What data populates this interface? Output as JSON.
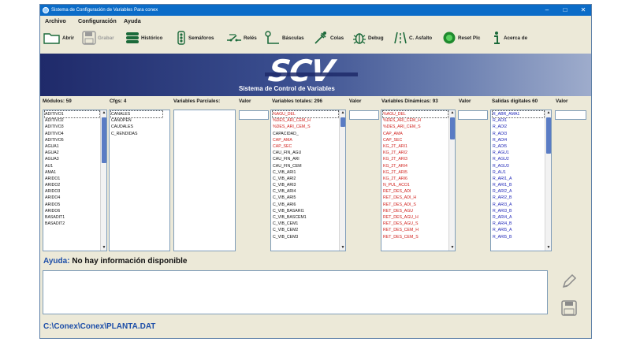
{
  "window": {
    "title": "Sistema de Configuración de Variables Para conex",
    "controls": {
      "minimize": "–",
      "maximize": "□",
      "close": "✕"
    }
  },
  "menu": [
    "Archivo",
    "Configuración",
    "Ayuda"
  ],
  "toolbar": [
    {
      "label": "Abrir",
      "icon": "folder-icon",
      "enabled": true
    },
    {
      "label": "Grabar",
      "icon": "save-icon",
      "enabled": false
    },
    {
      "label": "Histórico",
      "icon": "database-icon",
      "enabled": true
    },
    {
      "label": "Semáforos",
      "icon": "traffic-light-icon",
      "enabled": true
    },
    {
      "label": "Relés",
      "icon": "relay-switch-icon",
      "enabled": true
    },
    {
      "label": "Básculas",
      "icon": "scale-icon",
      "enabled": true
    },
    {
      "label": "Colas",
      "icon": "pipette-icon",
      "enabled": true
    },
    {
      "label": "Debug",
      "icon": "bug-icon",
      "enabled": true
    },
    {
      "label": "C. Asfalto",
      "icon": "road-icon",
      "enabled": true
    },
    {
      "label": "Reset Plc",
      "icon": "reset-green-icon",
      "enabled": true
    },
    {
      "label": "Acerca de",
      "icon": "info-icon",
      "enabled": true
    }
  ],
  "banner": {
    "logo": "SCV",
    "subtitle": "Sistema de Control de Variables"
  },
  "columns": {
    "modulos": {
      "header": "Módulos: 59",
      "items": [
        "ADITIVO1",
        "ADITIVO2",
        "ADITIVO3",
        "ADITIVO4",
        "ADITIVO5",
        "AGUA1",
        "AGUA2",
        "AGUA3",
        "AU1",
        "AMA1",
        "ARIDO1",
        "ARIDO2",
        "ARIDO3",
        "ARIDO4",
        "ARIDO5",
        "ARIDO6",
        "BASADIT1",
        "BASADIT2"
      ]
    },
    "cfgs": {
      "header": "Cfgs: 4",
      "items": [
        "CANALES",
        "CANOPEN",
        "CAUDALES",
        "C_RENDIDAS"
      ]
    },
    "parciales": {
      "header": "Variables Parciales:",
      "items": []
    },
    "valor1": {
      "header": "Valor"
    },
    "totales": {
      "header": "Variables totales: 296",
      "items": [
        {
          "t": "%AGU_DEL",
          "c": "red"
        },
        {
          "t": "%DES_ARI_CEM_H",
          "c": "red"
        },
        {
          "t": "%DES_ARI_CEM_S",
          "c": "red"
        },
        {
          "t": "CAPACIDAD_",
          "c": ""
        },
        {
          "t": "CAP_AMA",
          "c": "red"
        },
        {
          "t": "CAP_SEC",
          "c": "red"
        },
        {
          "t": "CAU_FIN_AGU",
          "c": ""
        },
        {
          "t": "CAU_FIN_ARI",
          "c": ""
        },
        {
          "t": "CAU_FIN_CEM",
          "c": ""
        },
        {
          "t": "C_VIB_ARI1",
          "c": ""
        },
        {
          "t": "C_VIB_ARI2",
          "c": ""
        },
        {
          "t": "C_VIB_ARI3",
          "c": ""
        },
        {
          "t": "C_VIB_ARI4",
          "c": ""
        },
        {
          "t": "C_VIB_ARI5",
          "c": ""
        },
        {
          "t": "C_VIB_ARI6",
          "c": ""
        },
        {
          "t": "C_VIB_BASARI1",
          "c": ""
        },
        {
          "t": "C_VIB_BASCEM1",
          "c": ""
        },
        {
          "t": "C_VIB_CEM1",
          "c": ""
        },
        {
          "t": "C_VIB_CEM2",
          "c": ""
        },
        {
          "t": "C_VIB_CEM3",
          "c": ""
        }
      ]
    },
    "valor2": {
      "header": "Valor"
    },
    "dinamicas": {
      "header": "Variables Dinámicas: 93",
      "items": [
        "%AGU_DEL",
        "%DES_ARI_CEM_H",
        "%DES_ARI_CEM_S",
        "CAP_AMA",
        "CAP_SEC",
        "KG_2T_ARI1",
        "KG_2T_ARI2",
        "KG_2T_ARI3",
        "KG_2T_ARI4",
        "KG_2T_ARI5",
        "KG_2T_ARI6",
        "N_PUL_ACO1",
        "RET_DES_ADI",
        "RET_DES_ADI_H",
        "RET_DES_ADI_S",
        "RET_DES_AGU",
        "RET_DES_AGU_H",
        "RET_DES_AGU_S",
        "RET_DES_CEM_H",
        "RET_DES_CEM_S"
      ]
    },
    "valor3": {
      "header": "Valor"
    },
    "salidas": {
      "header": "Salidas digitales 60",
      "items": [
        "R_ABR_AMA1",
        "R_ADI1",
        "R_ADI2",
        "R_ADI3",
        "R_ADI4",
        "R_ADI5",
        "R_AGU1",
        "R_AGU2",
        "R_AGU3",
        "R_AU1",
        "R_ARI1_A",
        "R_ARI1_B",
        "R_ARI2_A",
        "R_ARI2_B",
        "R_ARI3_A",
        "R_ARI3_B",
        "R_ARI4_A",
        "R_ARI4_B",
        "R_ARI5_A",
        "R_ARI5_B"
      ]
    },
    "valor4": {
      "header": "Valor"
    }
  },
  "help": {
    "label": "Ayuda:",
    "text": "No hay información disponible"
  },
  "side_buttons": {
    "edit": "pencil-icon",
    "save": "save-icon"
  },
  "file_path": "C:\\Conex\\Conex\\PLANTA.DAT",
  "colors": {
    "title_bar": "#0b6cc8",
    "help_blue": "#1d4ea8",
    "red_var": "#d0201c",
    "blue_var": "#2027b8",
    "scroll_thumb": "#5a7cc4"
  }
}
